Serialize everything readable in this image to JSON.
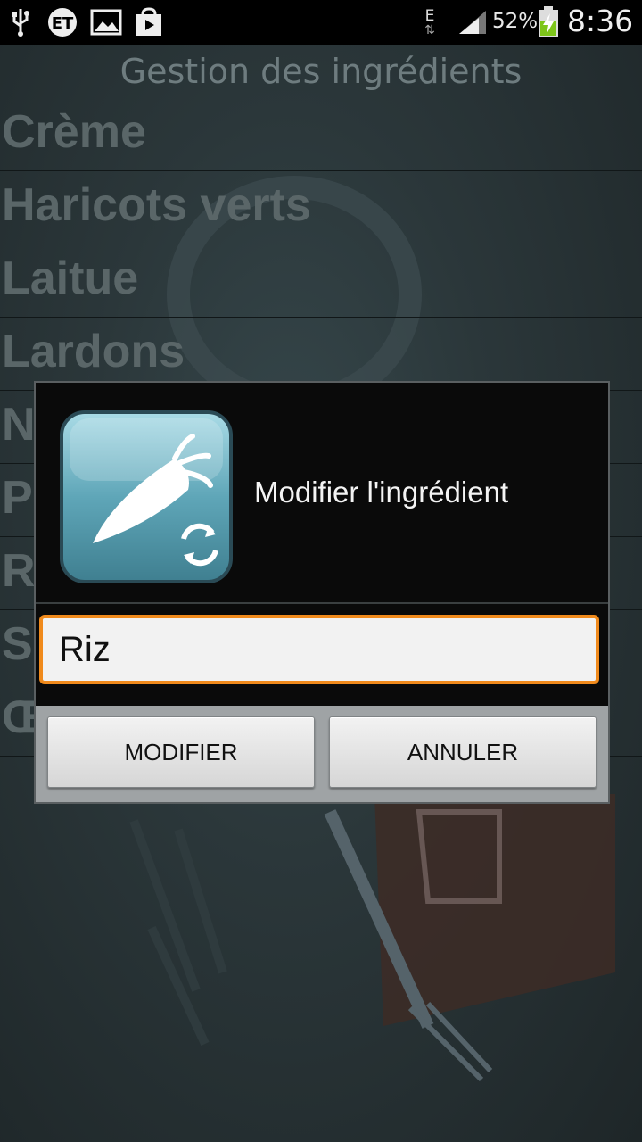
{
  "status_bar": {
    "battery_percent": "52%",
    "time": "8:36",
    "network_type": "E",
    "icons": [
      "usb-icon",
      "et-icon",
      "gallery-icon",
      "play-store-icon",
      "data-arrows-icon",
      "signal-icon",
      "battery-charging-icon"
    ]
  },
  "page": {
    "title": "Gestion des ingrédients"
  },
  "ingredients": [
    {
      "label": "Crème"
    },
    {
      "label": "Haricots verts"
    },
    {
      "label": "Laitue"
    },
    {
      "label": "Lardons"
    },
    {
      "label": "Nu"
    },
    {
      "label": "Pa"
    },
    {
      "label": "Riz"
    },
    {
      "label": "S"
    },
    {
      "label": "Œ"
    }
  ],
  "dialog": {
    "title": "Modifier l'ingrédient",
    "icon": "carrot-refresh-icon",
    "input_value": "Riz",
    "confirm_label": "MODIFIER",
    "cancel_label": "ANNULER"
  },
  "colors": {
    "accent_focus": "#f08a1c",
    "dialog_bg": "#0a0a0a",
    "icon_tile": "#5fa6b8"
  }
}
